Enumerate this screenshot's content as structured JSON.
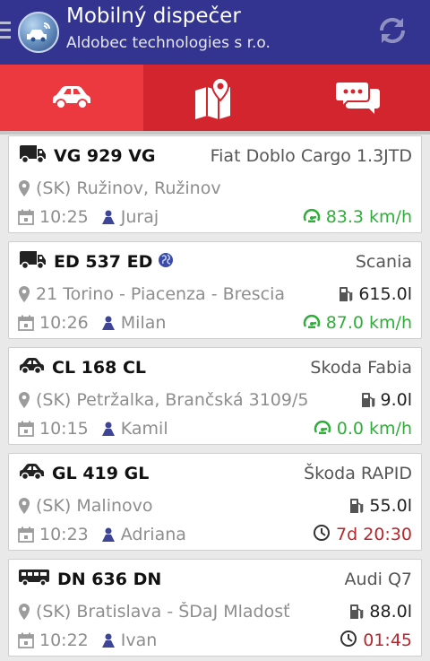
{
  "header": {
    "title": "Mobilný dispečer",
    "subtitle": "Aldobec technologies s r.o."
  },
  "tabs": [
    {
      "icon": "car-icon"
    },
    {
      "icon": "map-icon"
    },
    {
      "icon": "messages-icon"
    }
  ],
  "vehicles": [
    {
      "type": "van",
      "plate": "VG 929 VG",
      "model": "Fiat Doblo Cargo 1.3JTD",
      "address": "(SK) Ružinov, Ružinov",
      "fuel": "",
      "time": "10:25",
      "driver": "Juraj",
      "status_kind": "speed",
      "status": "83.3 km/h",
      "globe": false
    },
    {
      "type": "van",
      "plate": "ED 537 ED",
      "model": "Scania",
      "address": "21 Torino - Piacenza - Brescia",
      "fuel": "615.0l",
      "time": "10:26",
      "driver": "Milan",
      "status_kind": "speed",
      "status": "87.0 km/h",
      "globe": true
    },
    {
      "type": "car",
      "plate": "CL 168 CL",
      "model": "Skoda Fabia",
      "address": "(SK) Petržalka, Brančská 3109/5",
      "fuel": "9.0l",
      "time": "10:15",
      "driver": "Kamil",
      "status_kind": "speed",
      "status": "0.0 km/h",
      "globe": false
    },
    {
      "type": "car",
      "plate": "GL 419 GL",
      "model": "Škoda RAPID",
      "address": "(SK) Malinovo",
      "fuel": "55.0l",
      "time": "10:23",
      "driver": "Adriana",
      "status_kind": "clock",
      "status": "7d 20:30",
      "globe": false
    },
    {
      "type": "bus",
      "plate": "DN 636 DN",
      "model": "Audi Q7",
      "address": "(SK) Bratislava - ŠDaJ Mladosť",
      "fuel": "88.0l",
      "time": "10:22",
      "driver": "Ivan",
      "status_kind": "clock",
      "status": "01:45",
      "globe": false
    }
  ],
  "colors": {
    "appbar": "#32348f",
    "tabbar": "#d3252e",
    "tab_active": "#ec393f",
    "speed": "#2fae3a",
    "elapsed": "#b6262d"
  }
}
